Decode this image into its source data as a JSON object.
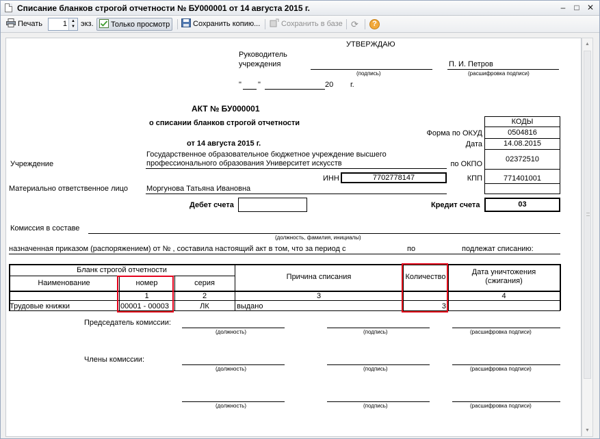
{
  "window": {
    "title": "Списание бланков строгой отчетности № БУ000001 от 14 августа 2015 г.",
    "minimize": "–",
    "maximize": "□",
    "close": "✕"
  },
  "toolbar": {
    "print_label": "Печать",
    "copies_value": "1",
    "copies_unit": "экз.",
    "view_only_label": "Только просмотр",
    "save_copy_label": "Сохранить копию...",
    "save_to_db_label": "Сохранить в базе",
    "refresh_glyph": "⟳",
    "help_glyph": "?"
  },
  "doc": {
    "approve": "УТВЕРЖДАЮ",
    "head_line1": "Руководитель",
    "head_line2": "учреждения",
    "head_name": "П. И. Петров",
    "caption_signature": "(подпись)",
    "caption_decoding": "(расшифровка подписи)",
    "date_open_quote": "\"",
    "date_close_quote": "\"",
    "date_year": "20",
    "date_suffix": "г.",
    "act_title": "АКТ № БУ000001",
    "act_subtitle": "о списании бланков строгой отчетности",
    "act_date": "от 14 августа 2015 г.",
    "codes_header": "КОДЫ",
    "form_label": "Форма  по ОКУД",
    "form_code": "0504816",
    "date_label": "Дата",
    "date_code": "14.08.2015",
    "institution_label": "Учреждение",
    "institution_line1": "Государственное образовательное бюджетное учреждение высшего",
    "institution_line2": "профессионального образования  Университет искусств",
    "okpo_label": "по ОКПО",
    "okpo_code": "02372510",
    "inn_label": "ИНН",
    "inn_value": "7702778147",
    "kpp_label": "КПП",
    "kpp_value": "771401001",
    "responsible_label": "Материально ответственное лицо",
    "responsible_name": "Моргунова Татьяна Ивановна",
    "debit_label": "Дебет счета",
    "credit_label": "Кредит счета",
    "credit_value": "03",
    "commission_label": "Комиссия в составе",
    "commission_caption": "(должность, фамилия, инициалы)",
    "order_text": "назначенная приказом (распоряжением) от    №   , составила настоящий акт в том, что за период с",
    "order_to": "по",
    "order_end": "подлежат списанию:",
    "chairman_label": "Председатель комиссии:",
    "members_label": "Члены комиссии:",
    "caption_position": "(должность)"
  },
  "table": {
    "group_header": "Бланк строгой отчетности",
    "col_name": "Наименование",
    "col_number": "номер",
    "col_series": "серия",
    "col_reason": "Причина списания",
    "col_quantity": "Количество",
    "col_destroy_1": "Дата уничтожения",
    "col_destroy_2": "(сжигания)",
    "num_1": "1",
    "num_2": "2",
    "num_3": "3",
    "num_4": "4",
    "rows": [
      {
        "name": "Трудовые книжки",
        "number": "00001 - 00003",
        "series": "ЛК",
        "reason": "выдано",
        "quantity": "3",
        "destroy": ""
      }
    ]
  },
  "colors": {
    "highlight": "#e3001b"
  }
}
